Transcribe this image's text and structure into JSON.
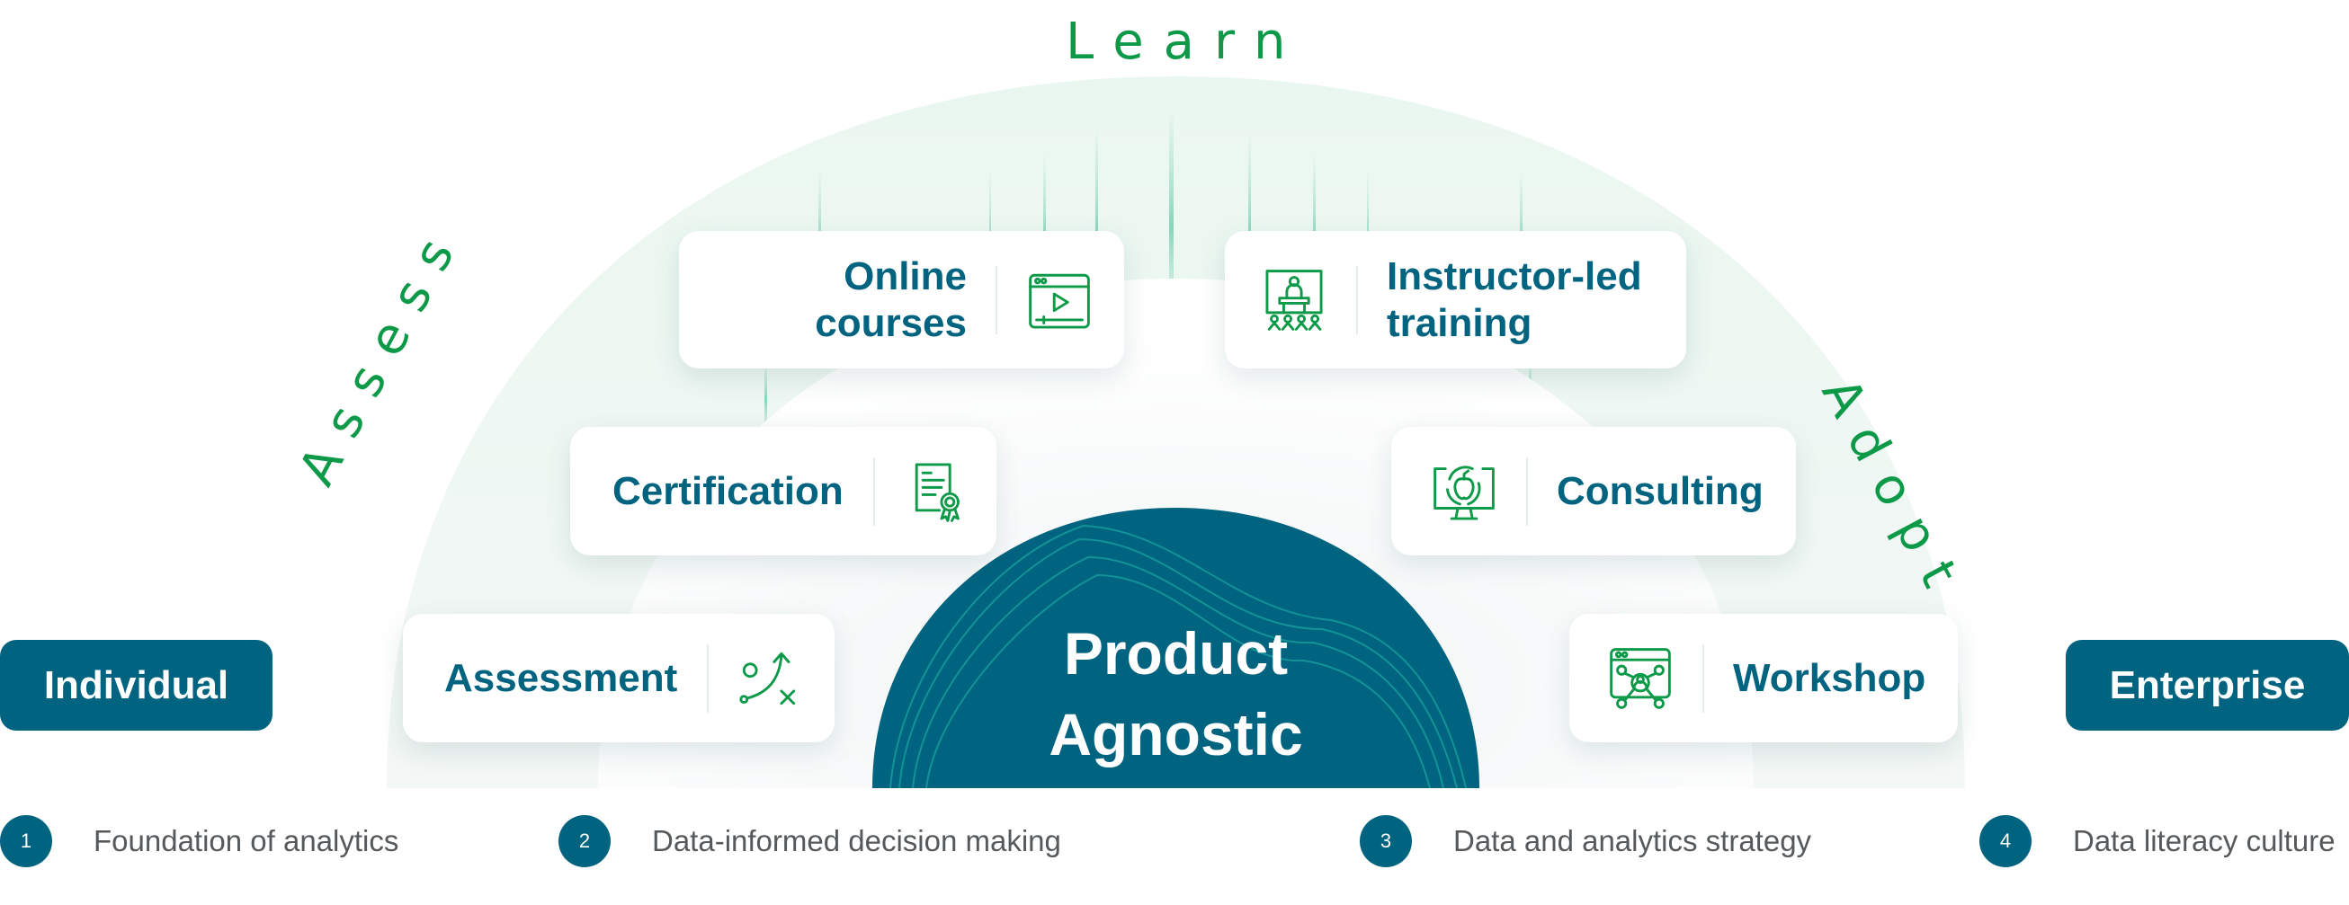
{
  "arc_labels": {
    "left": "Assess",
    "top": "Learn",
    "right": "Adopt"
  },
  "center": {
    "line1": "Product",
    "line2": "Agnostic"
  },
  "endpoints": {
    "left": "Individual",
    "right": "Enterprise"
  },
  "cards": [
    {
      "id": "online-courses",
      "line1": "Online",
      "line2": "courses",
      "icon": "video-player-icon"
    },
    {
      "id": "instructor-led-training",
      "line1": "Instructor-led",
      "line2": "training",
      "icon": "presenter-audience-icon"
    },
    {
      "id": "certification",
      "line1": "Certification",
      "icon": "certificate-icon"
    },
    {
      "id": "consulting",
      "line1": "Consulting",
      "icon": "monitor-cycle-icon"
    },
    {
      "id": "assessment",
      "line1": "Assessment",
      "icon": "strategy-play-icon"
    },
    {
      "id": "workshop",
      "line1": "Workshop",
      "icon": "browser-network-icon"
    }
  ],
  "steps": [
    {
      "num": "1",
      "label": "Foundation of analytics"
    },
    {
      "num": "2",
      "label": "Data-informed decision making"
    },
    {
      "num": "3",
      "label": "Data and analytics strategy"
    },
    {
      "num": "4",
      "label": "Data literacy culture"
    }
  ],
  "colors": {
    "primary": "#00637f",
    "accent_green": "#0d9a48",
    "arc_fill": "#eaf6f0",
    "step_text": "#55595c"
  }
}
